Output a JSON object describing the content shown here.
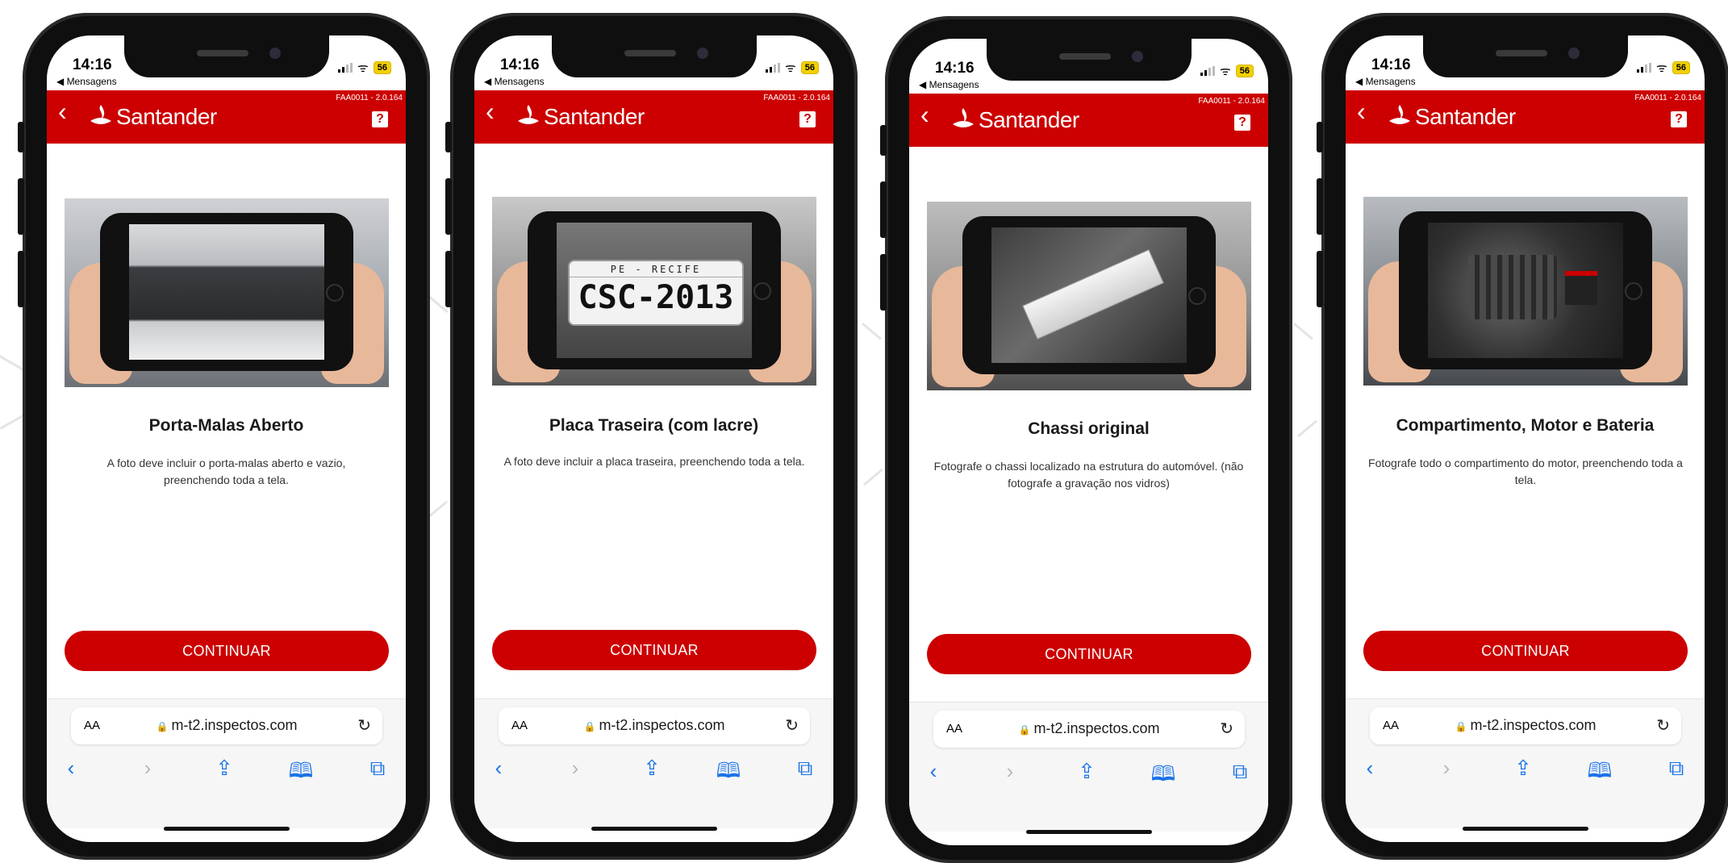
{
  "colors": {
    "brand_red": "#cc0000",
    "toolbar_bg": "#f6f6f6",
    "link_blue": "#1a73e8"
  },
  "icons": {
    "back": "chevron-left-icon",
    "help": "question-mark-icon",
    "lock": "lock-icon",
    "reload": "reload-icon",
    "share": "share-icon",
    "bookmarks": "book-icon",
    "tabs": "tabs-icon"
  },
  "phones": [
    {
      "status": {
        "time": "14:16",
        "back_app": "◀ Mensagens",
        "battery": "56"
      },
      "header": {
        "brand": "Santander",
        "version": "FAA0011 - 2.0.164",
        "help": "?"
      },
      "step": {
        "title": "Porta-Malas Aberto",
        "description": "A foto deve incluir o porta-malas aberto e vazio, preenchendo toda a tela.",
        "button": "CONTINUAR"
      },
      "browser": {
        "aa": "AA",
        "url": "m-t2.inspectos.com"
      }
    },
    {
      "status": {
        "time": "14:16",
        "back_app": "◀ Mensagens",
        "battery": "56"
      },
      "header": {
        "brand": "Santander",
        "version": "FAA0011 - 2.0.164",
        "help": "?"
      },
      "step": {
        "title": "Placa Traseira (com lacre)",
        "description": "A foto deve incluir a placa traseira, preenchendo toda a tela.",
        "button": "CONTINUAR",
        "plate_region": "PE - RECIFE",
        "plate_number": "CSC-2013"
      },
      "browser": {
        "aa": "AA",
        "url": "m-t2.inspectos.com"
      }
    },
    {
      "status": {
        "time": "14:16",
        "back_app": "◀ Mensagens",
        "battery": "56"
      },
      "header": {
        "brand": "Santander",
        "version": "FAA0011 - 2.0.164",
        "help": "?"
      },
      "step": {
        "title": "Chassi original",
        "description": "Fotografe o chassi localizado na estrutura do automóvel. (não fotografe a gravação nos vidros)",
        "button": "CONTINUAR"
      },
      "browser": {
        "aa": "AA",
        "url": "m-t2.inspectos.com"
      }
    },
    {
      "status": {
        "time": "14:16",
        "back_app": "◀ Mensagens",
        "battery": "56"
      },
      "header": {
        "brand": "Santander",
        "version": "FAA0011 - 2.0.164",
        "help": "?"
      },
      "step": {
        "title": "Compartimento, Motor e Bateria",
        "description": "Fotografe todo o compartimento do motor, preenchendo toda a tela.",
        "button": "CONTINUAR"
      },
      "browser": {
        "aa": "AA",
        "url": "m-t2.inspectos.com"
      }
    }
  ]
}
